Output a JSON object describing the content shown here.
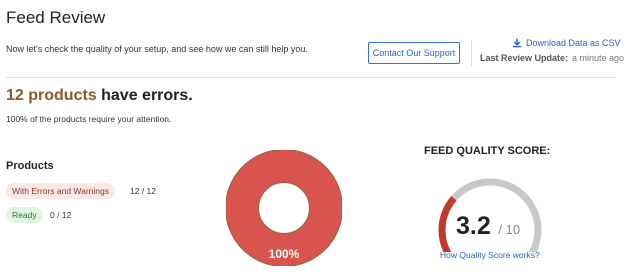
{
  "header": {
    "title": "Feed Review",
    "intro": "Now let's check the quality of your setup, and see how we can still help you.",
    "contact_button": "Contact Our Support",
    "download_label": "Download Data as CSV",
    "download_icon": "download-icon",
    "last_review_label": "Last Review Update:",
    "last_review_value": "a minute ago"
  },
  "summary": {
    "error_count_text": "12 products",
    "headline_rest": " have errors.",
    "subline": "100% of the products require your attention."
  },
  "products": {
    "label": "Products",
    "errors_badge": "With Errors and Warnings",
    "errors_count": "12 / 12",
    "ready_badge": "Ready",
    "ready_count": "0 / 12"
  },
  "donut": {
    "label": "100%",
    "error_fraction": 1.0,
    "error_color": "#d9534f",
    "ring_color": "#8b6a3e"
  },
  "score": {
    "title": "FEED QUALITY SCORE:",
    "value": "3.2",
    "separator": "/",
    "max": "10",
    "fraction": 0.32,
    "gauge_fill_color": "#c0392b",
    "gauge_track_color": "#c8c8c8",
    "link": "How Quality Score works?"
  },
  "colors": {
    "accent_brown": "#8b5a2b",
    "link_blue": "#2a5fc8",
    "error_badge_bg": "#fbe7e3",
    "ready_badge_bg": "#e2f3e2"
  }
}
